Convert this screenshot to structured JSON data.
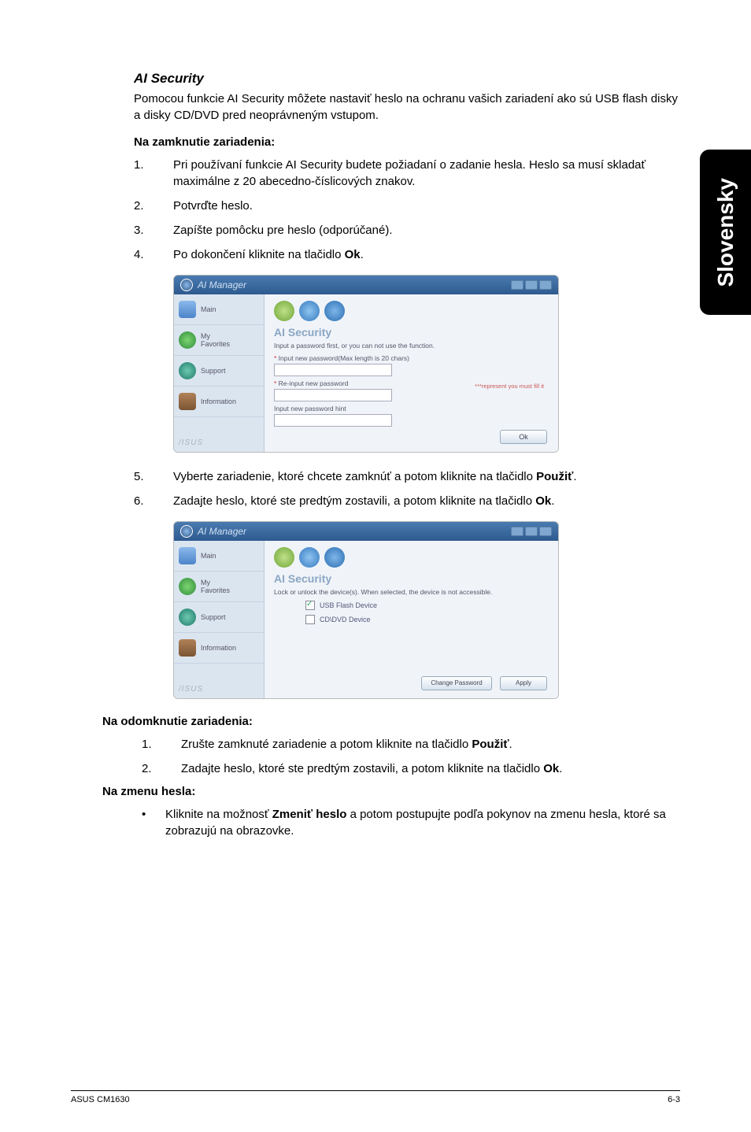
{
  "vertical_tab": "Slovensky",
  "section_title": "AI Security",
  "intro": "Pomocou funkcie AI Security môžete nastaviť heslo na ochranu vašich zariadení ako sú USB flash disky a disky CD/DVD pred neoprávneným vstupom.",
  "lock_heading": "Na zamknutie zariadenia:",
  "lock_steps": [
    "Pri používaní funkcie AI Security budete požiadaní o zadanie hesla. Heslo sa musí skladať maximálne z 20 abecedno-číslicových znakov.",
    "Potvrďte heslo.",
    "Zapíšte pomôcku pre heslo (odporúčané).",
    "Po dokončení kliknite na tlačidlo Ok."
  ],
  "lock_step4_prefix": "Po dokončení kliknite na tlačidlo ",
  "lock_step4_bold": "Ok",
  "lock_step4_suffix": ".",
  "screenshot1": {
    "title": "AI Manager",
    "sidebar": {
      "main": "Main",
      "favorites_line1": "My",
      "favorites_line2": "Favorites",
      "support": "Support",
      "information": "Information",
      "footer": "/ISUS"
    },
    "panel_title": "AI Security",
    "desc": "Input a password first, or you can not use the function.",
    "field1": "Input new password(Max length is 20 chars)",
    "field2": "Re-input new password",
    "field3": "Input new password hint",
    "note": "***represent you must fill it",
    "ok": "Ok"
  },
  "post_steps": {
    "step5_prefix": "Vyberte zariadenie, ktoré chcete zamknúť a potom kliknite na tlačidlo ",
    "step5_bold": "Použiť",
    "step5_suffix": ".",
    "step6_prefix": "Zadajte heslo, ktoré ste predtým zostavili, a potom kliknite na tlačidlo ",
    "step6_bold": "Ok",
    "step6_suffix": "."
  },
  "screenshot2": {
    "title": "AI Manager",
    "sidebar": {
      "main": "Main",
      "favorites_line1": "My",
      "favorites_line2": "Favorites",
      "support": "Support",
      "information": "Information",
      "footer": "/ISUS"
    },
    "panel_title": "AI Security",
    "desc": "Lock or unlock the device(s). When selected, the device is not accessible.",
    "check1": "USB Flash Device",
    "check2": "CD\\DVD Device",
    "btn_change": "Change Password",
    "btn_apply": "Apply"
  },
  "unlock_heading": "Na odomknutie zariadenia:",
  "unlock_step1_prefix": "Zrušte zamknuté zariadenie a potom kliknite na tlačidlo ",
  "unlock_step1_bold": "Použiť",
  "unlock_step1_suffix": ".",
  "unlock_step2_prefix": "Zadajte heslo, ktoré ste predtým zostavili, a potom kliknite na tlačidlo ",
  "unlock_step2_bold": "Ok",
  "unlock_step2_suffix": ".",
  "changepw_heading": "Na zmenu hesla:",
  "changepw_prefix": "Kliknite na možnosť ",
  "changepw_bold": "Zmeniť heslo",
  "changepw_suffix": " a potom postupujte podľa pokynov na zmenu hesla, ktoré sa zobrazujú na obrazovke.",
  "footer_left": "ASUS CM1630",
  "footer_right": "6-3"
}
